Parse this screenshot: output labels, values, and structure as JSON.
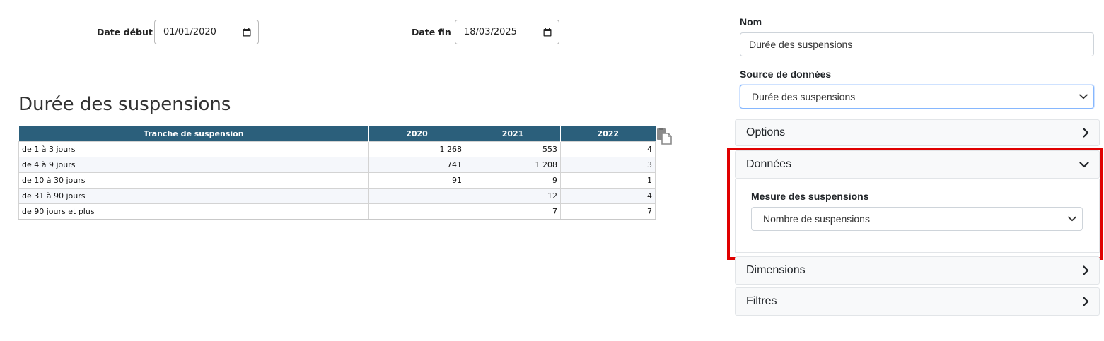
{
  "filters": {
    "start_label": "Date début",
    "start_value": "01/01/2020",
    "end_label": "Date fin",
    "end_value": "18/03/2025"
  },
  "report": {
    "title": "Durée des suspensions",
    "table": {
      "headers": [
        "Tranche de suspension",
        "2020",
        "2021",
        "2022"
      ],
      "rows": [
        [
          "de 1 à 3 jours",
          "1 268",
          "553",
          "4"
        ],
        [
          "de 4 à 9 jours",
          "741",
          "1 208",
          "3"
        ],
        [
          "de 10 à 30 jours",
          "91",
          "9",
          "1"
        ],
        [
          "de 31 à 90 jours",
          "",
          "12",
          "4"
        ],
        [
          "de 90 jours et plus",
          "",
          "7",
          "7"
        ]
      ]
    }
  },
  "panel": {
    "name_label": "Nom",
    "name_value": "Durée des suspensions",
    "source_label": "Source de données",
    "source_value": "Durée des suspensions",
    "sections": {
      "options": "Options",
      "donnees": "Données",
      "dimensions": "Dimensions",
      "filtres": "Filtres"
    },
    "measure_label": "Mesure des suspensions",
    "measure_value": "Nombre de suspensions"
  },
  "colors": {
    "table_header": "#2b5f7b",
    "highlight": "#e00000"
  },
  "icons": {
    "calendar": "calendar-icon",
    "copy": "copy-icon",
    "chevron_right": "chevron-right-icon",
    "chevron_down": "chevron-down-icon"
  }
}
